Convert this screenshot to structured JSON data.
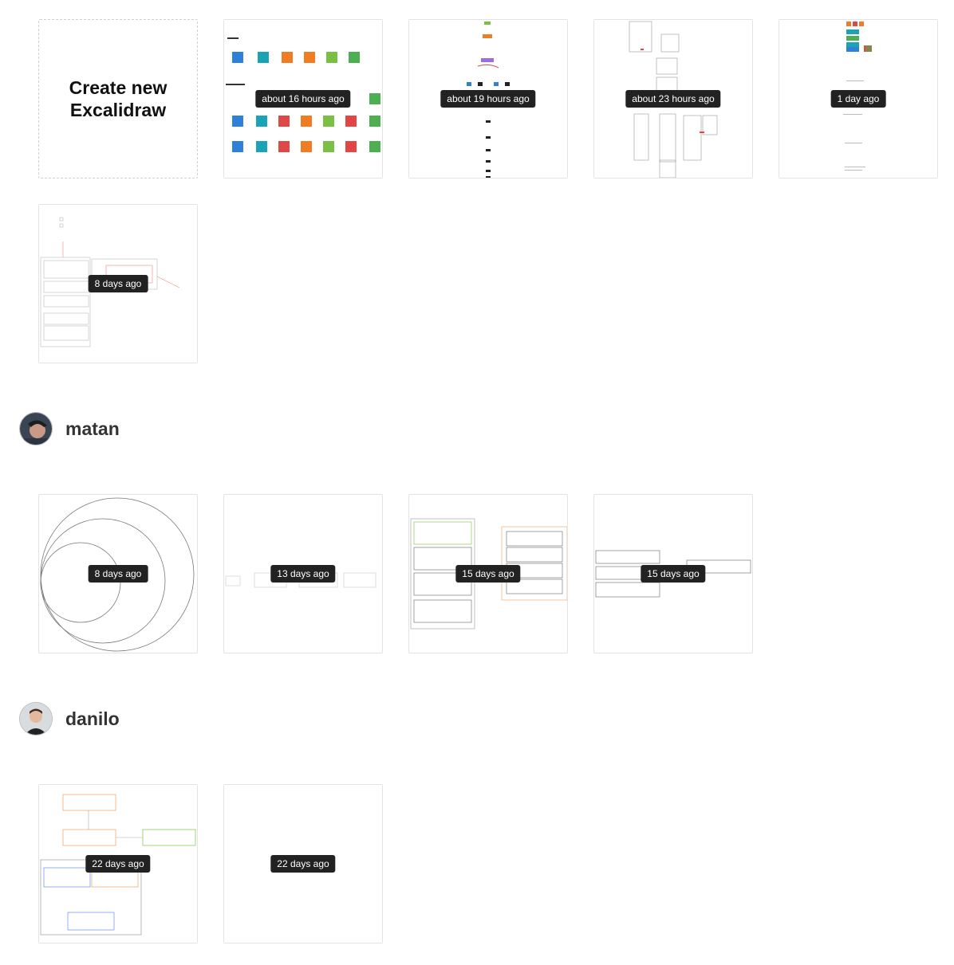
{
  "create_card": {
    "label": "Create new\nExcalidraw"
  },
  "sections": [
    {
      "user": null,
      "drawings": [
        {
          "badge": "about 16 hours ago"
        },
        {
          "badge": "about 19 hours ago"
        },
        {
          "badge": "about 23 hours ago"
        },
        {
          "badge": "1 day ago"
        },
        {
          "badge": "8 days ago"
        }
      ]
    },
    {
      "user": "matan",
      "drawings": [
        {
          "badge": "8 days ago"
        },
        {
          "badge": "13 days ago"
        },
        {
          "badge": "15 days ago"
        },
        {
          "badge": "15 days ago"
        }
      ]
    },
    {
      "user": "danilo",
      "drawings": [
        {
          "badge": "22 days ago"
        },
        {
          "badge": "22 days ago"
        }
      ]
    }
  ]
}
